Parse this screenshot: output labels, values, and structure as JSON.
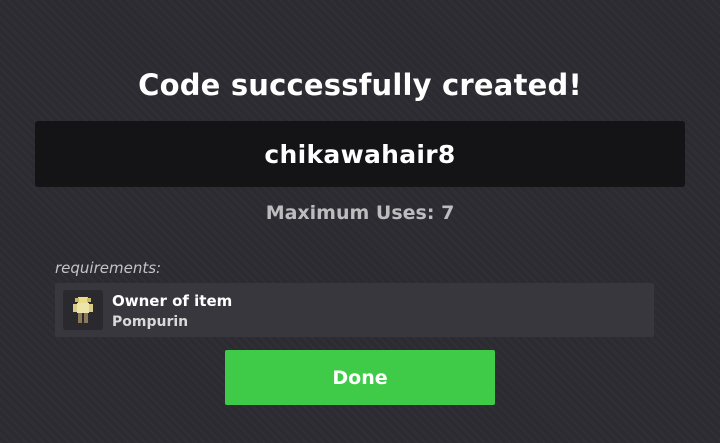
{
  "dialog": {
    "title": "Code successfully created!",
    "code": "chikawahair8",
    "max_uses_label": "Maximum Uses: 7",
    "requirements_label": "requirements:",
    "requirement": {
      "title": "Owner of item",
      "item_name": "Pompurin",
      "thumbnail_icon": "pompurin-item-thumbnail"
    },
    "done_label": "Done"
  },
  "colors": {
    "background": "#2b2b31",
    "code_box": "#141416",
    "requirement_card": "#37373d",
    "done_button": "#3fcb47"
  }
}
